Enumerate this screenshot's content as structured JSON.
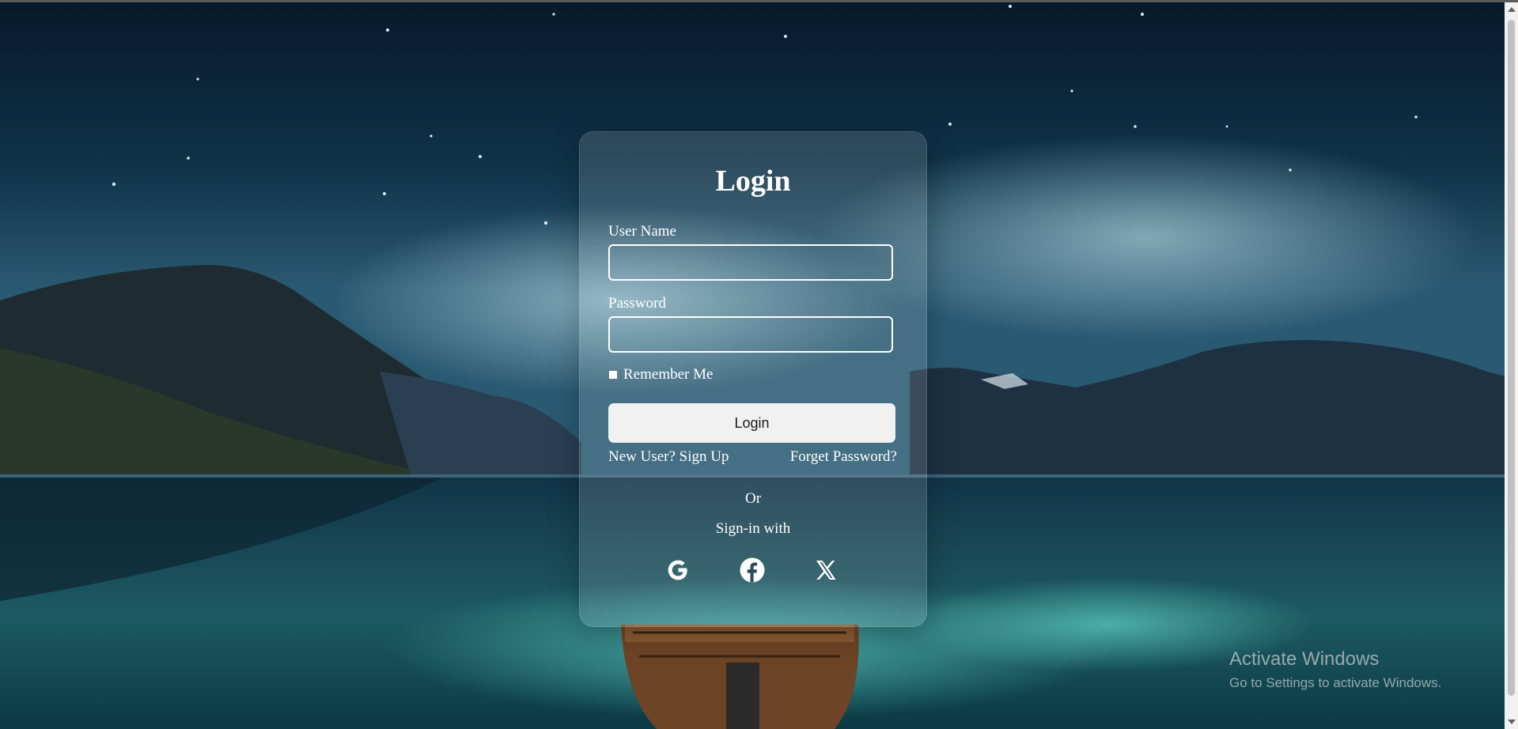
{
  "form": {
    "title": "Login",
    "username_label": "User Name",
    "username_value": "",
    "password_label": "Password",
    "password_value": "",
    "remember_label": "Remember Me",
    "remember_checked": false,
    "login_button": "Login",
    "signup_link": "New User? Sign Up",
    "forgot_link": "Forget Password?",
    "or_text": "Or",
    "signin_with_text": "Sign-in with"
  },
  "social_icons": [
    "google-icon",
    "facebook-icon",
    "x-icon"
  ],
  "watermark": {
    "line1": "Activate Windows",
    "line2": "Go to Settings to activate Windows."
  },
  "colors": {
    "text": "#ffffff",
    "button_bg": "#f1f1f1",
    "card_tint": "rgba(255,255,255,0.13)"
  }
}
